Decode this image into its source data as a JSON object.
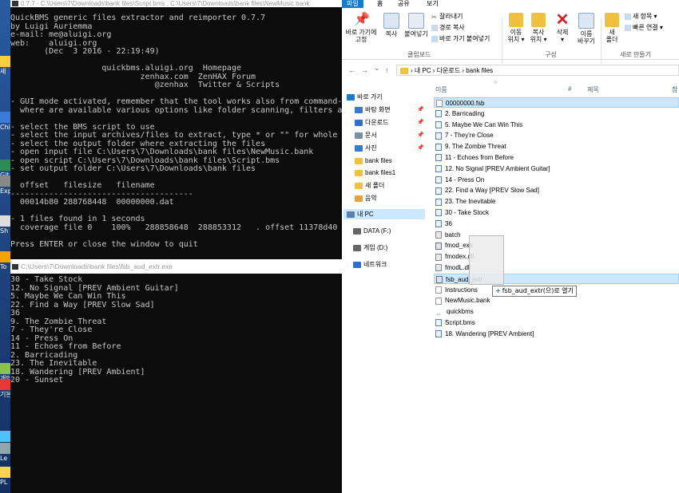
{
  "desktop": {
    "items": [
      "새",
      "Chi",
      "Git",
      "Expe",
      "Sh",
      "To",
      "개인",
      "기본",
      "Ro",
      "Le",
      "PL"
    ]
  },
  "console1": {
    "title": "0.7.7 - C:\\Users\\7\\Downloads\\bank files\\Script.bms , C:\\Users\\7\\Downloads\\bank files\\NewMusic.bank",
    "lines": [
      "QuickBMS generic files extractor and reimporter 0.7.7",
      "by Luigi Auriemma",
      "e-mail: me@aluigi.org",
      "web:    aluigi.org",
      "       (Dec  3 2016 - 22:19:49)",
      "",
      "                   quickbms.aluigi.org  Homepage",
      "                           zenhax.com  ZenHAX Forum",
      "                              @zenhax  Twitter & Scripts",
      "",
      "- GUI mode activated, remember that the tool works also from command-line",
      "  where are available various options like folder scanning, filters and so on",
      "",
      "- select the BMS script to use",
      "- select the input archives/files to extract, type * or \"\" for whole folder and",
      "- select the output folder where extracting the files",
      "- open input file C:\\Users\\7\\Downloads\\bank files\\NewMusic.bank",
      "- open script C:\\Users\\7\\Downloads\\bank files\\Script.bms",
      "- set output folder C:\\Users\\7\\Downloads\\bank files",
      "",
      "  offset   filesize   filename",
      "--------------------------------------",
      "  00014b80 288768448  00000000.dat",
      "",
      "- 1 files found in 1 seconds",
      "  coverage file 0    100%   288858648  288853312   . offset 11378d40",
      "",
      "Press ENTER or close the window to quit"
    ]
  },
  "console2": {
    "title": "C:\\Users\\7\\Downloads\\bank files\\fsb_aud_extr.exe",
    "lines": [
      "30 - Take Stock",
      "12. No Signal [PREV Ambient Guitar]",
      "5. Maybe We Can Win This",
      "22. Find a Way [PREV Slow Sad]",
      "36",
      "9. The Zombie Threat",
      "7 - They're Close",
      "14 - Press On",
      "11 - Echoes from Before",
      "2. Barricading",
      "23. The Inevitable",
      "18. Wandering [PREV Ambient]",
      "20 - Sunset"
    ]
  },
  "explorer": {
    "tabs": [
      "파일",
      "홈",
      "공유",
      "보기"
    ],
    "ribbon": {
      "pin_quick": "바로 가기에\n고정",
      "copy": "복사",
      "paste": "붙여넣기",
      "cut": "잘라내기",
      "copy_path": "경로 복사",
      "paste_shortcut": "바로 가기 붙여넣기",
      "move_to": "이동\n위치 ▾",
      "copy_to": "복사\n위치 ▾",
      "delete": "삭제\n▾",
      "rename": "이름\n바꾸기",
      "new_folder": "새\n폴더",
      "new_item": "새 항목 ▾",
      "easy_access": "빠른 연결 ▾",
      "group_clipboard": "클립보드",
      "group_organize": "구성",
      "group_new": "새로 만들기"
    },
    "address": {
      "crumbs": "› 내 PC  ›  다운로드  ›  bank files"
    },
    "nav": {
      "back": "←",
      "forward": "→",
      "recent": "⌄",
      "up": "↑"
    },
    "sidebar": [
      {
        "label": "바로 가기",
        "pinned": false
      },
      {
        "label": "바탕 화면",
        "pinned": true
      },
      {
        "label": "다운로드",
        "pinned": true
      },
      {
        "label": "문서",
        "pinned": true
      },
      {
        "label": "사진",
        "pinned": true
      },
      {
        "label": "bank files",
        "pinned": false
      },
      {
        "label": "bank files1",
        "pinned": false
      },
      {
        "label": "새 폴더",
        "pinned": false
      },
      {
        "label": "음악",
        "pinned": false
      },
      {
        "label": "내 PC",
        "pinned": false
      },
      {
        "label": "DATA (F:)",
        "pinned": false
      },
      {
        "label": "게임 (D:)",
        "pinned": false
      },
      {
        "label": "네트워크",
        "pinned": false
      }
    ],
    "columns": {
      "name": "이름",
      "num": "#",
      "title": "제목",
      "extra": "참"
    },
    "files": [
      {
        "name": "00000000.fsb",
        "type": "plain"
      },
      {
        "name": "2. Barricading",
        "type": "audio"
      },
      {
        "name": "5. Maybe We Can Win This",
        "type": "audio"
      },
      {
        "name": "7 - They're Close",
        "type": "audio"
      },
      {
        "name": "9. The Zombie Threat",
        "type": "audio"
      },
      {
        "name": "11 - Echoes from Before",
        "type": "audio"
      },
      {
        "name": "12. No Signal [PREV Ambient Guitar]",
        "type": "audio"
      },
      {
        "name": "14 - Press On",
        "type": "audio"
      },
      {
        "name": "22. Find a Way [PREV Slow Sad]",
        "type": "audio"
      },
      {
        "name": "23. The Inevitable",
        "type": "audio"
      },
      {
        "name": "30 - Take Stock",
        "type": "audio"
      },
      {
        "name": "36",
        "type": "audio"
      },
      {
        "name": "batch",
        "type": "gear"
      },
      {
        "name": "fmod_extr",
        "type": "exe"
      },
      {
        "name": "fmodex.dll",
        "type": "gear"
      },
      {
        "name": "fmodL.dll",
        "type": "gear"
      },
      {
        "name": "fsb_aud_extr",
        "type": "exe"
      },
      {
        "name": "Instructions",
        "type": "plain"
      },
      {
        "name": "NewMusic.bank",
        "type": "plain"
      },
      {
        "name": "quickbms",
        "type": "link"
      },
      {
        "name": "Script.bms",
        "type": "audio"
      },
      {
        "name": "18. Wandering [PREV Ambient]",
        "type": "audio"
      }
    ],
    "drag_tooltip": "fsb_aud_extr(으)로 열기"
  },
  "colors": {
    "accent": "#1979ca",
    "selection": "#cce8ff",
    "console_bg": "#0c0c0c",
    "console_text": "#c8c8c8"
  }
}
